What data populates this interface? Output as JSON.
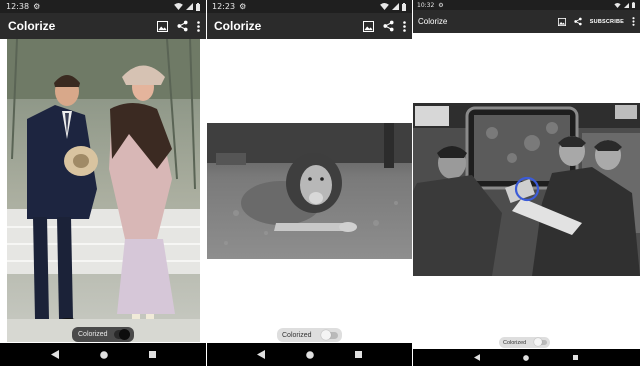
{
  "screens": [
    {
      "status": {
        "time": "12:38"
      },
      "appbar": {
        "title": "Colorize"
      },
      "toggle": {
        "label": "Colorized",
        "on": true
      }
    },
    {
      "status": {
        "time": "12:23"
      },
      "appbar": {
        "title": "Colorize"
      },
      "toggle": {
        "label": "Colorized",
        "on": false
      }
    },
    {
      "status": {
        "time": "10:32"
      },
      "appbar": {
        "title": "Colorize",
        "subscribe_label": "SUBSCRIBE"
      },
      "toggle": {
        "label": "Colorized",
        "on": false
      }
    }
  ],
  "icons": {
    "status_left": [
      "gear-icon"
    ],
    "status_right": [
      "wifi-icon",
      "signal-icon",
      "battery-icon"
    ],
    "appbar_actions": [
      "image-icon",
      "share-icon",
      "more-vert-icon"
    ],
    "navbar": [
      "back-icon",
      "home-icon",
      "recents-icon"
    ]
  },
  "colors": {
    "statusbar": "#1f1f1f",
    "appbar": "#2b2b2b",
    "toggle_on_bg": "#4a4a4a",
    "toggle_off_bg": "#dedede",
    "tap_indicator": "#3b5bd8"
  }
}
